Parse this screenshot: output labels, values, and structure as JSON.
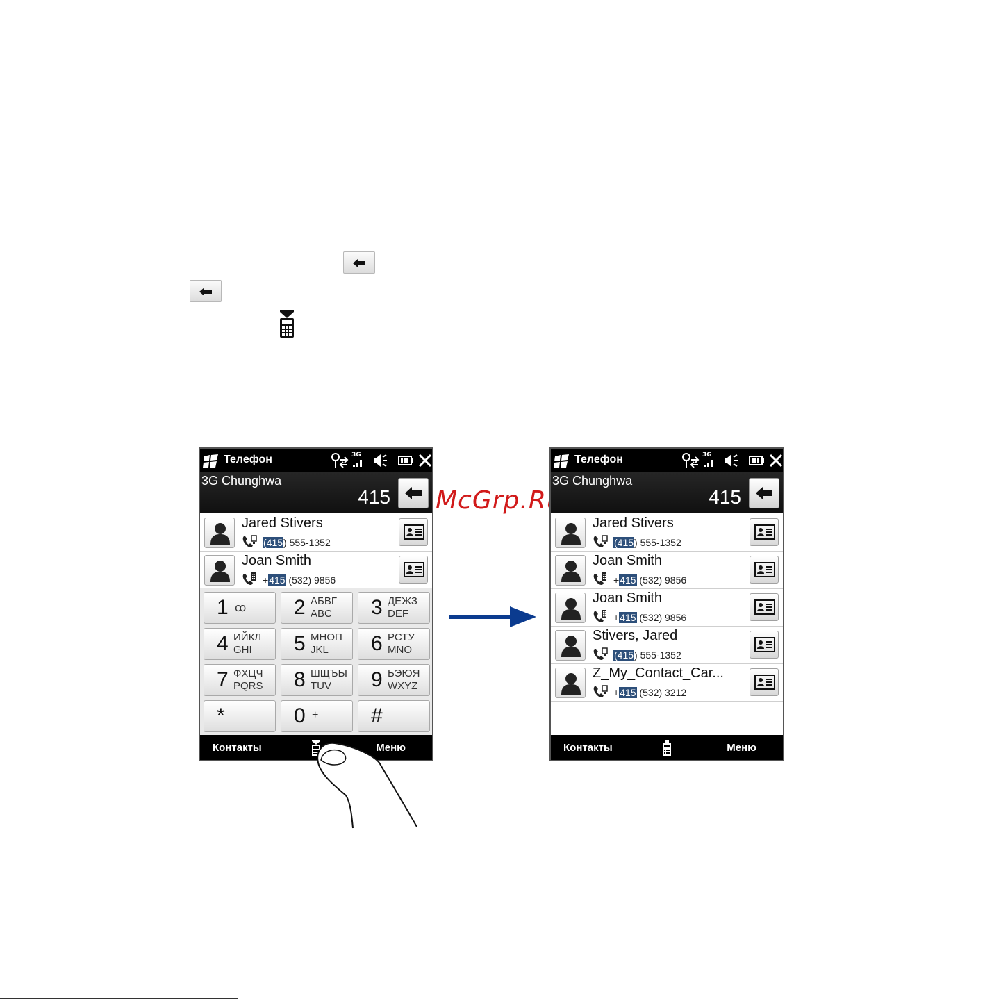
{
  "manual": {
    "icons": [
      "backspace-icon",
      "backspace-icon",
      "phone-keypad-icon"
    ]
  },
  "watermark": "McGrp.Ru",
  "screens": [
    {
      "title": "Телефон",
      "carrier": "3G Chunghwa",
      "number": "415",
      "network_label": "3G",
      "contacts": [
        {
          "name": "Jared Stivers",
          "prefix": "",
          "hl": "(415",
          "rest": ") 555-1352",
          "type": "home-phone-icon"
        },
        {
          "name": "Joan Smith",
          "prefix": "+",
          "hl": "415",
          "rest": " (532) 9856",
          "type": "office-phone-icon"
        }
      ],
      "keys": [
        {
          "d": "1",
          "s1": "",
          "s2": "",
          "m": "ꝏ"
        },
        {
          "d": "2",
          "s1": "АБВГ",
          "s2": "ABC",
          "m": ""
        },
        {
          "d": "3",
          "s1": "ДЕЖЗ",
          "s2": "DEF",
          "m": ""
        },
        {
          "d": "4",
          "s1": "ИЙКЛ",
          "s2": "GHI",
          "m": ""
        },
        {
          "d": "5",
          "s1": "МНОП",
          "s2": "JKL",
          "m": ""
        },
        {
          "d": "6",
          "s1": "РСТУ",
          "s2": "MNO",
          "m": ""
        },
        {
          "d": "7",
          "s1": "ФХЦЧ",
          "s2": "PQRS",
          "m": ""
        },
        {
          "d": "8",
          "s1": "ШЩЪЫ",
          "s2": "TUV",
          "m": ""
        },
        {
          "d": "9",
          "s1": "ЬЭЮЯ",
          "s2": "WXYZ",
          "m": ""
        },
        {
          "d": "*",
          "s1": "",
          "s2": "",
          "m": ""
        },
        {
          "d": "0",
          "s1": "",
          "s2": "",
          "m": "+"
        },
        {
          "d": "#",
          "s1": "",
          "s2": "",
          "m": ""
        }
      ],
      "menu": {
        "left": "Контакты",
        "right": "Меню"
      }
    },
    {
      "title": "Телефон",
      "carrier": "3G Chunghwa",
      "number": "415",
      "network_label": "3G",
      "contacts": [
        {
          "name": "Jared Stivers",
          "prefix": "",
          "hl": "(415",
          "rest": ") 555-1352",
          "type": "home-phone-icon"
        },
        {
          "name": "Joan Smith",
          "prefix": "+",
          "hl": "415",
          "rest": " (532) 9856",
          "type": "office-phone-icon"
        },
        {
          "name": "Joan Smith",
          "prefix": "+",
          "hl": "415",
          "rest": " (532) 9856",
          "type": "office-phone-icon"
        },
        {
          "name": "Stivers, Jared",
          "prefix": "",
          "hl": "(415",
          "rest": ") 555-1352",
          "type": "home-phone-icon"
        },
        {
          "name": "Z_My_Contact_Car...",
          "prefix": "+",
          "hl": "415",
          "rest": " (532) 3212",
          "type": "home-phone-icon"
        }
      ],
      "menu": {
        "left": "Контакты",
        "right": "Меню"
      }
    }
  ]
}
